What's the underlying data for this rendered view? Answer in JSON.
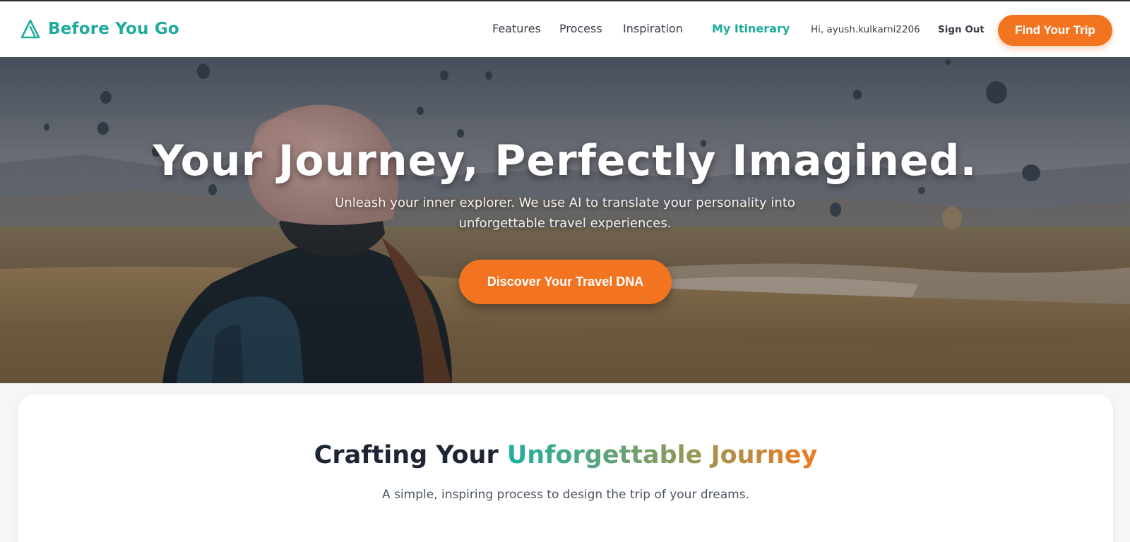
{
  "header": {
    "logo_text": "Before You Go",
    "nav": {
      "features": "Features",
      "process": "Process",
      "inspiration": "Inspiration",
      "itinerary": "My Itinerary"
    },
    "greeting": "Hi, ayush.kulkarni2206",
    "sign_out": "Sign Out",
    "cta": "Find Your Trip"
  },
  "hero": {
    "title": "Your Journey, Perfectly Imagined.",
    "subtitle_line1": "Unleash your inner explorer. We use AI to translate your personality into",
    "subtitle_line2": "unforgettable travel experiences.",
    "cta": "Discover Your Travel DNA",
    "background": "photo of a traveler in a knit beanie with backpack overlooking a valley with hot air balloons at dusk"
  },
  "section": {
    "title_part1": "Crafting Your",
    "title_part2": "Unforgettable Journey",
    "subtitle": "A simple, inspiring process to design the trip of your dreams."
  },
  "colors": {
    "brand_teal": "#1faa9c",
    "accent_orange": "#f37420",
    "text_dark": "#1c2533"
  },
  "icons": {
    "logo": "triangle-a-logo-icon"
  }
}
